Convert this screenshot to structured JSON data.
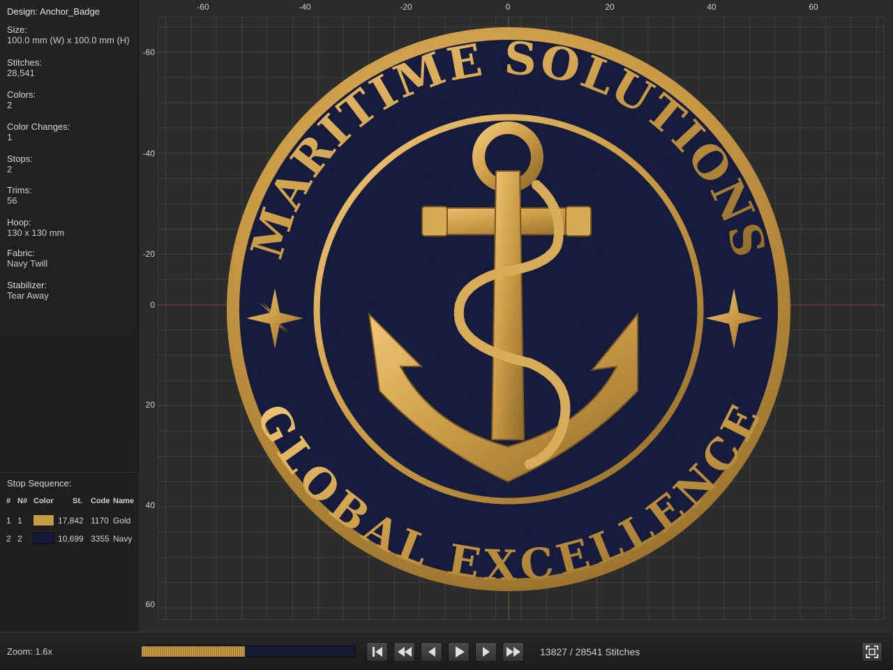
{
  "design": {
    "title": "Design: Anchor_Badge"
  },
  "properties": [
    {
      "label": "Size:",
      "value": "100.0 mm (W) x 100.0 mm (H)"
    },
    {
      "label": "Stitches:",
      "value": "28,541"
    },
    {
      "label": "Colors:",
      "value": "2"
    },
    {
      "label": "Color Changes:",
      "value": "1"
    },
    {
      "label": "Stops:",
      "value": "2"
    },
    {
      "label": "Trims:",
      "value": "56"
    },
    {
      "label": "Hoop:",
      "value": "130 x 130 mm"
    },
    {
      "label": "Fabric:",
      "value": "Navy Twill"
    },
    {
      "label": "Stabilizer:",
      "value": "Tear Away"
    }
  ],
  "stop_sequence": {
    "title": "Stop Sequence:",
    "headers": {
      "num": "#",
      "needle": "N#",
      "color": "Color",
      "stitches": "St.",
      "code": "Code",
      "name": "Name"
    },
    "rows": [
      {
        "num": "1",
        "needle": "1",
        "swatch": "#c99a45",
        "stitches": "17,842",
        "code": "1170",
        "name": "Gold"
      },
      {
        "num": "2",
        "needle": "2",
        "swatch": "#151a3a",
        "stitches": "10,699",
        "code": "3355",
        "name": "Navy"
      }
    ]
  },
  "ruler": {
    "x_ticks": [
      "-60",
      "-40",
      "-20",
      "0",
      "20",
      "40",
      "60"
    ],
    "y_ticks": [
      "-60",
      "-40",
      "-20",
      "0",
      "20",
      "40",
      "60"
    ]
  },
  "patch": {
    "top_text": "MARITIME SOLUTIONS",
    "bottom_text": "GLOBAL EXCELLENCE",
    "colors": {
      "gold": "#c99a45",
      "navy": "#151a3a"
    }
  },
  "playback": {
    "zoom": "Zoom: 1.6x",
    "progress": 0.4845,
    "current": "13827",
    "separator": "/",
    "total": "28541 Stitches"
  },
  "icons": {
    "first": "skip-to-start-icon",
    "rewind": "rewind-icon",
    "back": "step-back-icon",
    "play": "play-icon",
    "forward": "step-forward-icon",
    "fast_forward": "fast-forward-icon",
    "fit": "fit-to-screen-icon"
  }
}
